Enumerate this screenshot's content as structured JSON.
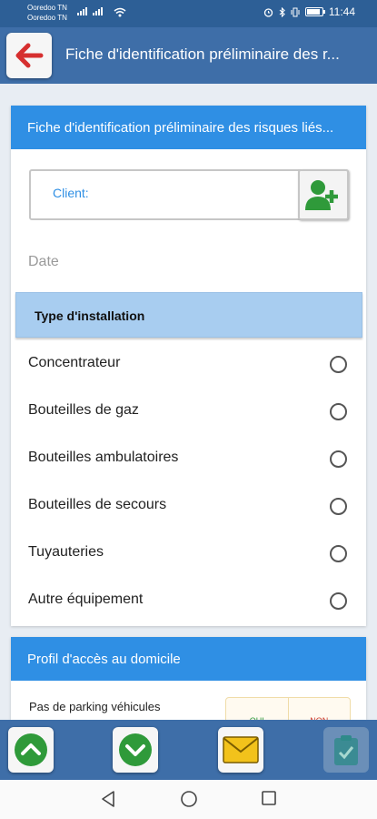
{
  "status_bar": {
    "carrier1": "Ooredoo TN",
    "carrier2": "Ooredoo TN",
    "time": "11:44"
  },
  "app_bar": {
    "title": "Fiche d'identification préliminaire des r...",
    "back_icon": "arrow-left-icon"
  },
  "form_card": {
    "header": "Fiche d'identification préliminaire des risques liés...",
    "client_label": "Client:",
    "add_client_icon": "add-user-icon",
    "date_label": "Date",
    "installation_header": "Type d'installation",
    "options": [
      {
        "label": "Concentrateur",
        "selected": false
      },
      {
        "label": "Bouteilles de gaz",
        "selected": false
      },
      {
        "label": "Bouteilles ambulatoires",
        "selected": false
      },
      {
        "label": "Bouteilles de secours",
        "selected": false
      },
      {
        "label": "Tuyauteries",
        "selected": false
      },
      {
        "label": "Autre équipement",
        "selected": false
      }
    ]
  },
  "access_card": {
    "header": "Profil d'accès au domicile",
    "question": "Pas de parking véhicules",
    "yes_label": "OUI",
    "no_label": "NON"
  },
  "toolbar": {
    "icons": [
      "chevron-up-icon",
      "chevron-down-icon",
      "mail-icon",
      "clipboard-check-icon"
    ]
  },
  "colors": {
    "app_bar": "#3e6ea8",
    "card_header": "#2f8fe4",
    "section_header": "#a8cdf0",
    "back_arrow": "#d62f2f",
    "green": "#2f9a3a",
    "mail": "#f2c21b"
  }
}
